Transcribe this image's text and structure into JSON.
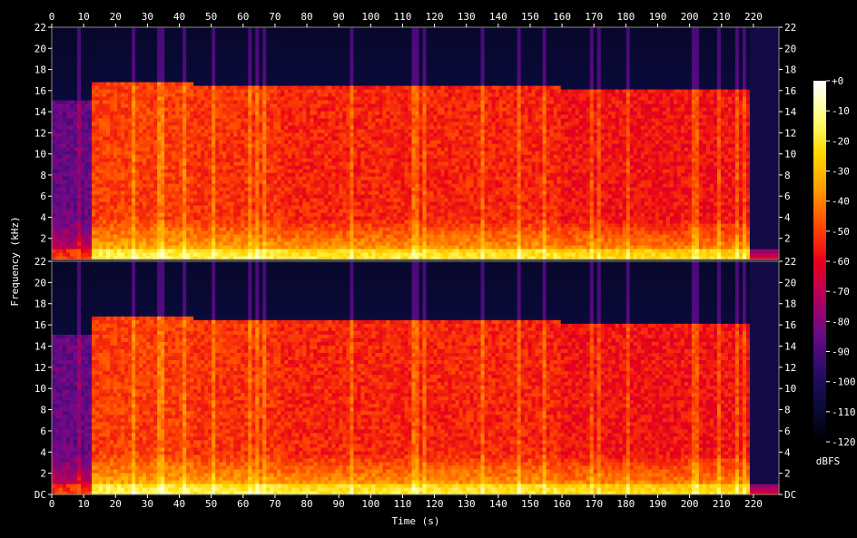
{
  "chart_data": {
    "type": "heatmap",
    "title": "",
    "xlabel": "Time (s)",
    "ylabel": "Frequency (kHz)",
    "xlim": [
      0,
      228
    ],
    "ylim": [
      0,
      22
    ],
    "x_ticks": [
      0,
      10,
      20,
      30,
      40,
      50,
      60,
      70,
      80,
      90,
      100,
      110,
      120,
      130,
      140,
      150,
      160,
      170,
      180,
      190,
      200,
      210,
      220
    ],
    "y_ticks": [
      "DC",
      "2",
      "4",
      "6",
      "8",
      "10",
      "12",
      "14",
      "16",
      "18",
      "20",
      "22"
    ],
    "y_ticks_upper_bottom": "2",
    "channels": 2,
    "colorbar": {
      "label": "dBFS",
      "range": [
        -120,
        0
      ],
      "ticks": [
        "+0",
        "-10",
        "-20",
        "-30",
        "-40",
        "-50",
        "-60",
        "-70",
        "-80",
        "-90",
        "-100",
        "-110",
        "-120"
      ]
    },
    "segments": [
      {
        "start": 0,
        "end": 12,
        "level_db": -85,
        "cutoff_khz": 15.2
      },
      {
        "start": 13,
        "end": 44,
        "level_db": -50,
        "cutoff_khz": 16.7
      },
      {
        "start": 44,
        "end": 72,
        "level_db": -52,
        "cutoff_khz": 16.6
      },
      {
        "start": 72,
        "end": 160,
        "level_db": -54,
        "cutoff_khz": 16.5
      },
      {
        "start": 160,
        "end": 219,
        "level_db": -57,
        "cutoff_khz": 16.3
      },
      {
        "start": 219,
        "end": 228,
        "level_db": -105,
        "cutoff_khz": 0
      }
    ],
    "colors": {
      "background": "#000000",
      "scale": [
        "#000000",
        "#0a0a3a",
        "#2d0a6a",
        "#6a0a8a",
        "#b00060",
        "#e8001a",
        "#ff4a00",
        "#ff9a00",
        "#ffd800",
        "#ffff80",
        "#ffffff"
      ]
    }
  }
}
